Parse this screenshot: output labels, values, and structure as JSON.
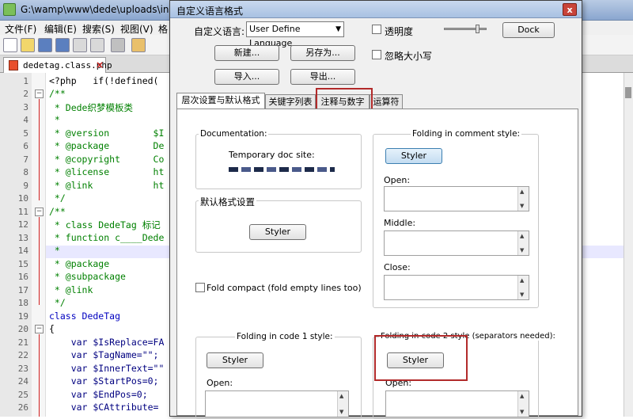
{
  "editor": {
    "title": "G:\\wamp\\www\\dede\\uploads\\includ",
    "menu": [
      "文件(F)",
      "编辑(E)",
      "搜索(S)",
      "视图(V)",
      "格"
    ],
    "tab_label": "dedetag.class.php",
    "tab_close": "×",
    "line_numbers": [
      "1",
      "2",
      "3",
      "4",
      "5",
      "6",
      "7",
      "8",
      "9",
      "10",
      "11",
      "12",
      "13",
      "14",
      "15",
      "16",
      "17",
      "18",
      "19",
      "20",
      "21",
      "22",
      "23",
      "24",
      "25",
      "26"
    ],
    "lines": [
      "<?php   if(!defined(",
      "/**",
      " * Dede织梦模板类",
      " *",
      " * @version        $I",
      " * @package        De",
      " * @copyright      Co",
      " * @license        ht",
      " * @link           ht",
      " */",
      "/**",
      " * class DedeTag 标记",
      " * function c____Dede",
      " *",
      " * @package",
      " * @subpackage",
      " * @link",
      " */",
      "class DedeTag",
      "{",
      "    var $IsReplace=FA",
      "    var $TagName=\"\";",
      "    var $InnerText=\"\"",
      "    var $StartPos=0;",
      "    var $EndPos=0;",
      "    var $CAttribute="
    ]
  },
  "dialog": {
    "title": "自定义语言格式",
    "close": "x",
    "lang_label": "自定义语言:",
    "lang_select": "User Define Language",
    "transparency_label": "透明度",
    "ignore_case_label": "忽略大小写",
    "dock_button": "Dock",
    "new_button": "新建...",
    "save_as_button": "另存为...",
    "import_button": "导入...",
    "export_button": "导出...",
    "tabs": [
      "层次设置与默认格式",
      "关键字列表",
      "注释与数字",
      "运算符"
    ],
    "documentation_group": "Documentation:",
    "temp_doc_site": "Temporary doc site:",
    "default_style_group": "默认格式设置",
    "styler": "Styler",
    "fold_compact_label": "Fold compact (fold empty lines too)",
    "folding_comment_group": "Folding in comment style:",
    "open_label": "Open:",
    "middle_label": "Middle:",
    "close_label": "Close:",
    "folding_code1_group": "Folding in code 1 style:",
    "folding_code2_group": "Folding in code 2 style (separators needed):",
    "open_label2": "Open:",
    "open_label3": "Open:"
  },
  "colors": {
    "highlight_box": "#b22a2a",
    "comment": "#008000",
    "keyword": "#0000c0"
  }
}
